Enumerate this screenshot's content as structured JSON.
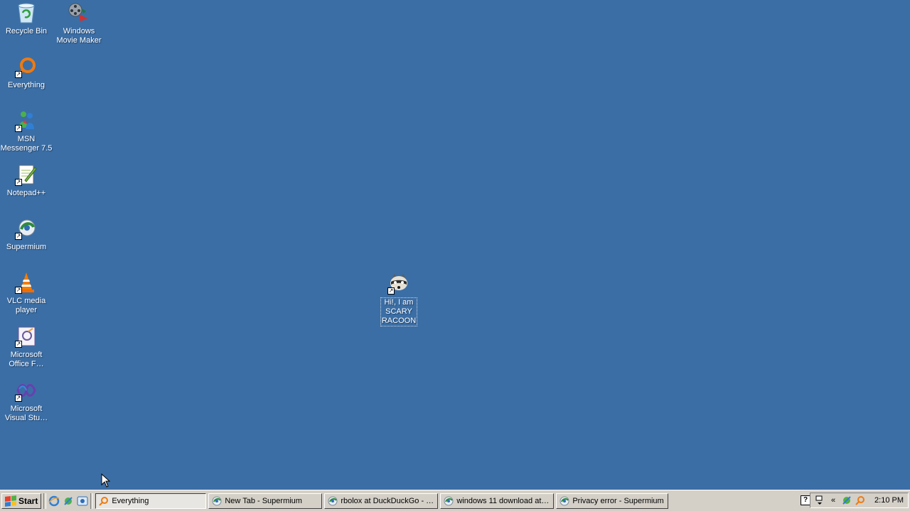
{
  "desktop": {
    "background_color": "#3b6ea5",
    "icons": [
      {
        "label": "Recycle Bin",
        "icon": "recycle-bin-icon"
      },
      {
        "label": "Windows\nMovie Maker",
        "icon": "movie-maker-icon"
      },
      {
        "label": "Everything",
        "icon": "everything-icon"
      },
      {
        "label": "MSN\nMessenger 7.5",
        "icon": "msn-messenger-icon"
      },
      {
        "label": "Notepad++",
        "icon": "notepad-plus-plus-icon"
      },
      {
        "label": "Supermium",
        "icon": "supermium-icon"
      },
      {
        "label": "VLC media\nplayer",
        "icon": "vlc-icon"
      },
      {
        "label": "Microsoft\nOffice F…",
        "icon": "office-icon"
      },
      {
        "label": "Microsoft\nVisual Stu…",
        "icon": "visual-studio-icon"
      },
      {
        "label": "Hi!, I am\nSCARY\nRACOON",
        "icon": "raccoon-icon"
      }
    ]
  },
  "taskbar": {
    "start_label": "Start",
    "quick_launch": [
      "internet-explorer-icon",
      "network-icon",
      "outlook-express-icon"
    ],
    "tasks": [
      {
        "label": "Everything",
        "icon": "everything-icon",
        "active": true
      },
      {
        "label": "New Tab - Supermium",
        "icon": "supermium-icon",
        "active": false
      },
      {
        "label": "rbolox at DuckDuckGo - …",
        "icon": "supermium-icon",
        "active": false
      },
      {
        "label": "windows 11 download at…",
        "icon": "supermium-icon",
        "active": false
      },
      {
        "label": "Privacy error - Supermium",
        "icon": "supermium-icon",
        "active": false
      }
    ],
    "tray": {
      "expand_label": "«",
      "clock": "2:10 PM"
    }
  }
}
